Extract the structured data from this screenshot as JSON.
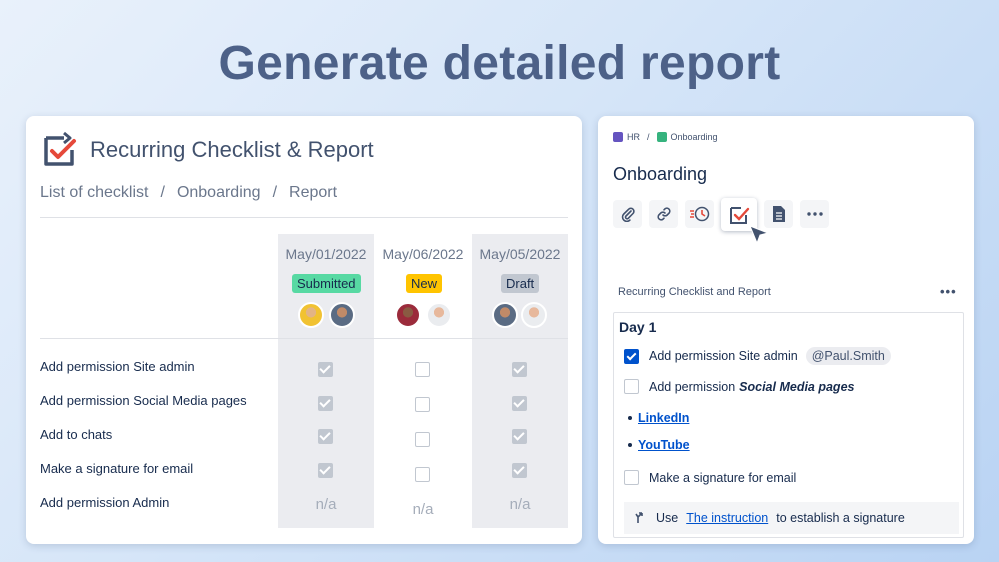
{
  "hero": {
    "title": "Generate detailed report"
  },
  "left": {
    "title": "Recurring Checklist & Report",
    "breadcrumb": [
      "List of checklist",
      "/",
      "Onboarding",
      "/",
      "Report"
    ],
    "columns": [
      {
        "date": "May/01/2022",
        "status": "Submitted",
        "status_color": "#57d9a3"
      },
      {
        "date": "May/06/2022",
        "status": "New",
        "status_color": "#ffc400"
      },
      {
        "date": "May/05/2022",
        "status": "Draft",
        "status_color": "#c1c7d0"
      }
    ],
    "rows": [
      {
        "label": "Add permission Site admin",
        "cells": [
          "checked",
          "empty",
          "checked"
        ]
      },
      {
        "label": "Add permission Social Media pages",
        "cells": [
          "checked",
          "empty",
          "checked"
        ]
      },
      {
        "label": "Add to chats",
        "cells": [
          "checked",
          "empty",
          "checked"
        ]
      },
      {
        "label": "Make a signature for email",
        "cells": [
          "checked",
          "empty",
          "checked"
        ]
      },
      {
        "label": "Add permission Admin",
        "cells": [
          "n/a",
          "n/a",
          "n/a"
        ]
      }
    ],
    "na_text": "n/a"
  },
  "right": {
    "breadcrumb": {
      "space": "HR",
      "sep": "/",
      "page": "Onboarding"
    },
    "page_title": "Onboarding",
    "toolbar": [
      "paperclip-icon",
      "link-icon",
      "speed-clock-icon",
      "checklist-icon",
      "document-icon",
      "more-icon"
    ],
    "section_title": "Recurring Checklist and Report",
    "more": "•••",
    "day": "Day 1",
    "items": [
      {
        "text": "Add permission Site admin",
        "mention": "@Paul.Smith",
        "checked": true
      },
      {
        "text": "Add permission",
        "emph": "Social Media pages",
        "checked": false
      },
      {
        "text": "Make a signature for email",
        "checked": false
      }
    ],
    "links": [
      "LinkedIn",
      "YouTube"
    ],
    "info": {
      "prefix": "Use",
      "link": "The instruction",
      "suffix": "to establish a signature"
    }
  },
  "colors": {
    "accent": "#0052cc",
    "hero": "#4d6188",
    "check": "#e5493a"
  }
}
